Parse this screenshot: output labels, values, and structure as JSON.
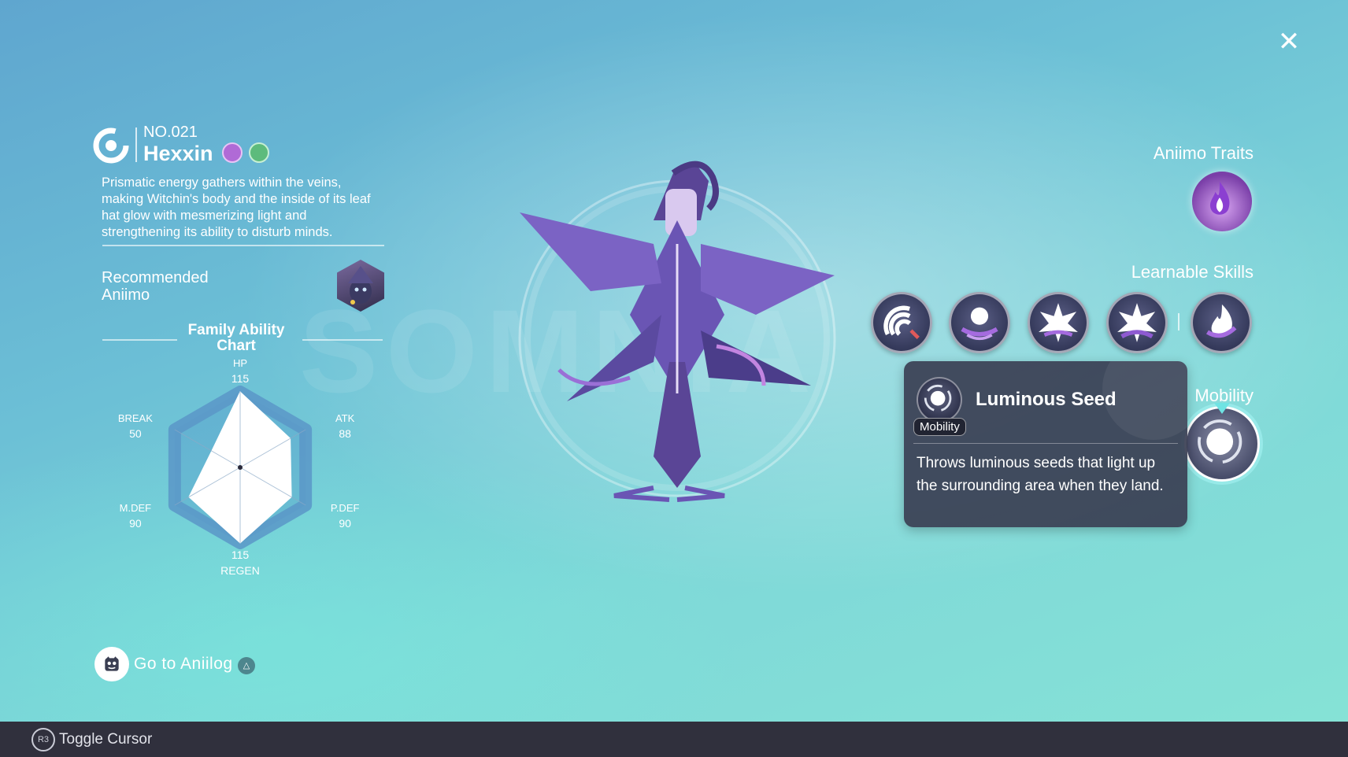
{
  "close": {
    "glyph": "✕"
  },
  "header": {
    "number": "NO.021",
    "name": "Hexxin",
    "types": [
      "psychic-type-icon",
      "grass-type-icon"
    ]
  },
  "description": "Prismatic energy gathers within the veins, making Witchin's body and the inside of its leaf hat glow with mesmerizing light and strengthening its ability to disturb minds.",
  "recommended": {
    "label": "Recommended Aniimo"
  },
  "ability_chart": {
    "title": "Family Ability Chart",
    "stats": [
      {
        "name": "HP",
        "value": "115"
      },
      {
        "name": "ATK",
        "value": "88"
      },
      {
        "name": "P.DEF",
        "value": "90"
      },
      {
        "name": "REGEN",
        "value": "115"
      },
      {
        "name": "M.DEF",
        "value": "90"
      },
      {
        "name": "BREAK",
        "value": "50"
      }
    ]
  },
  "chart_data": {
    "type": "radar",
    "categories": [
      "HP",
      "ATK",
      "P.DEF",
      "REGEN",
      "M.DEF",
      "BREAK"
    ],
    "values": [
      115,
      88,
      90,
      115,
      90,
      50
    ],
    "title": "Family Ability Chart",
    "ylim": [
      0,
      115
    ]
  },
  "aniilog": {
    "label": "Go to Aniilog",
    "hint": "△"
  },
  "traits": {
    "title": "Aniimo Traits",
    "icon": "flame-trait-icon"
  },
  "skills": {
    "title": "Learnable Skills",
    "items": [
      "sonic-wave-skill-icon",
      "vortex-orb-skill-icon",
      "burst-skill-icon",
      "burst-plus-skill-icon",
      "purple-flame-skill-icon"
    ]
  },
  "mobility": {
    "title": "Mobility"
  },
  "tooltip": {
    "name": "Luminous Seed",
    "tag": "Mobility",
    "description": "Throws luminous seeds that light up the surrounding area when they land."
  },
  "bottom_bar": {
    "button": "R3",
    "label": "Toggle Cursor"
  },
  "colors": {
    "accent": "#6fe3e3",
    "panel": "#3a3e52",
    "bar": "#30303d"
  }
}
